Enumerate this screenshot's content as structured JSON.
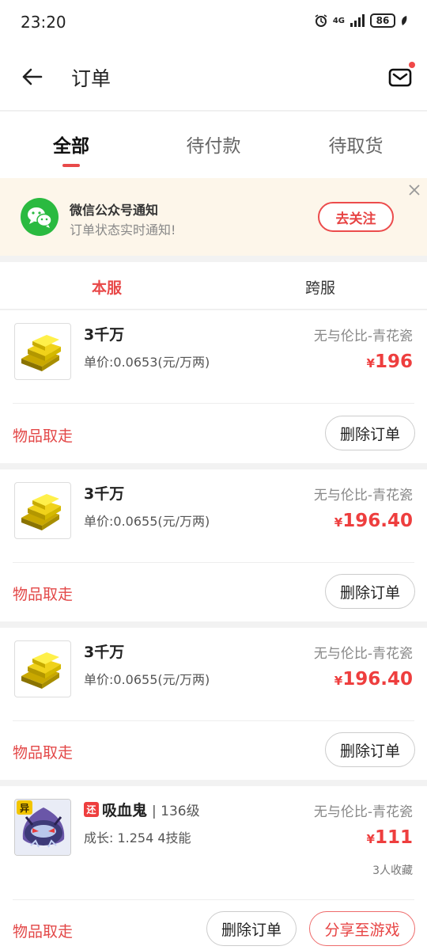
{
  "status_bar": {
    "time": "23:20",
    "network": "4G",
    "battery": "86"
  },
  "header": {
    "title": "订单"
  },
  "tabs": [
    {
      "label": "全部"
    },
    {
      "label": "待付款"
    },
    {
      "label": "待取货"
    }
  ],
  "notice": {
    "title": "微信公众号通知",
    "subtitle": "订单状态实时通知!",
    "button": "去关注"
  },
  "subtabs": [
    {
      "label": "本服"
    },
    {
      "label": "跨服"
    }
  ],
  "orders": [
    {
      "name": "3千万",
      "unit_price": "单价:0.0653(元/万两)",
      "server": "无与伦比-青花瓷",
      "currency": "¥",
      "price": "196",
      "status": "物品取走",
      "delete_label": "删除订单"
    },
    {
      "name": "3千万",
      "unit_price": "单价:0.0655(元/万两)",
      "server": "无与伦比-青花瓷",
      "currency": "¥",
      "price": "196.40",
      "status": "物品取走",
      "delete_label": "删除订单"
    },
    {
      "name": "3千万",
      "unit_price": "单价:0.0655(元/万两)",
      "server": "无与伦比-青花瓷",
      "currency": "¥",
      "price": "196.40",
      "status": "物品取走",
      "delete_label": "删除订单"
    },
    {
      "tag": "还",
      "name": "吸血鬼",
      "level": "| 136级",
      "unit_price": "成长: 1.254 4技能",
      "server": "无与伦比-青花瓷",
      "currency": "¥",
      "price": "111",
      "favorites": "3人收藏",
      "status": "物品取走",
      "delete_label": "删除订单",
      "share_label": "分享至游戏",
      "thumb_badge": "异"
    }
  ],
  "colors": {
    "accent": "#e84848",
    "wechat": "#2aba40",
    "notice_bg": "#fdf6ea"
  }
}
